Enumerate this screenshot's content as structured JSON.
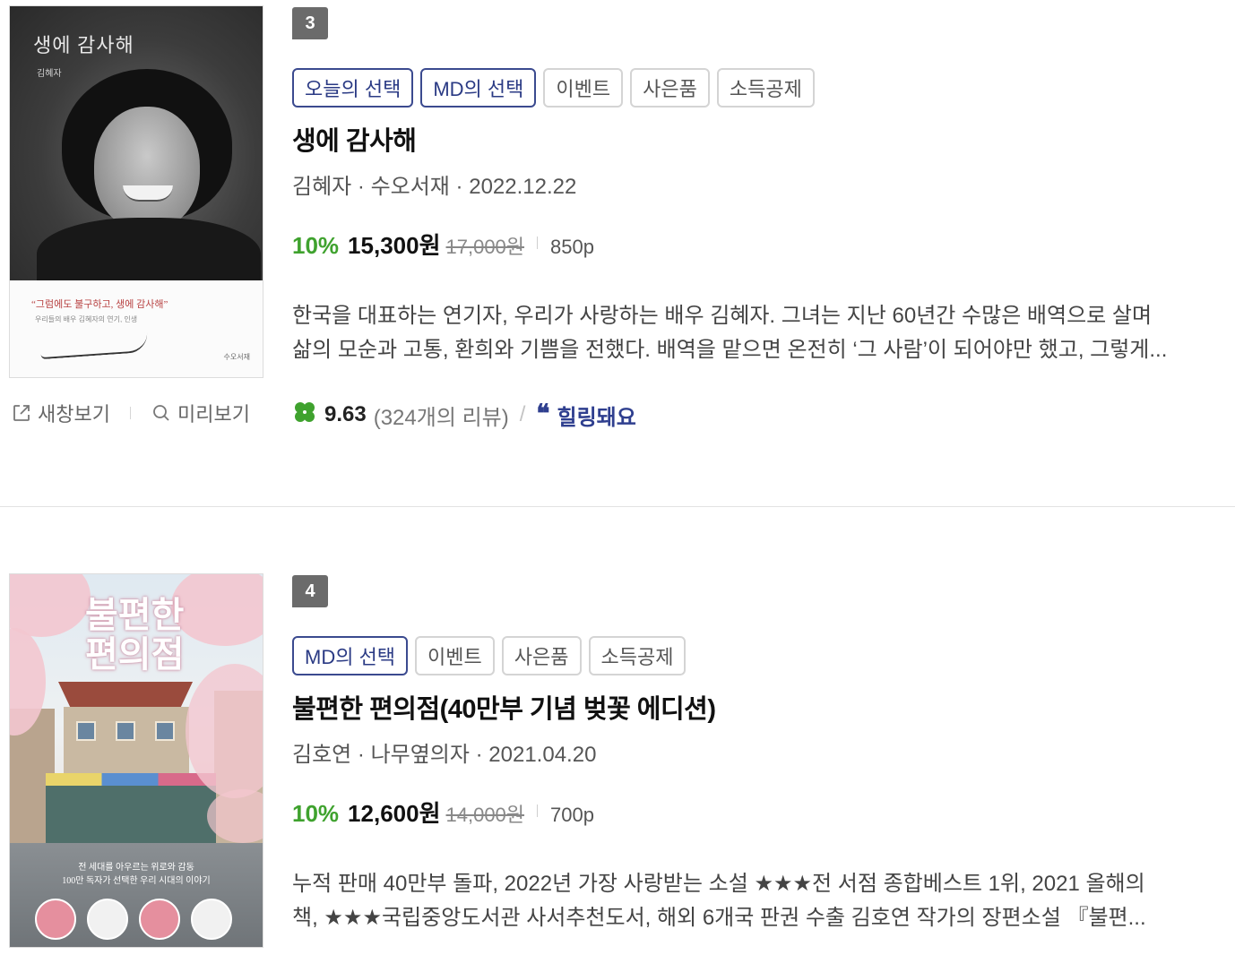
{
  "sub_actions": {
    "new_window_label": "새창보기",
    "preview_label": "미리보기"
  },
  "books": [
    {
      "rank": "3",
      "tags": [
        "오늘의 선택",
        "MD의 선택",
        "이벤트",
        "사은품",
        "소득공제"
      ],
      "title": "생에 감사해",
      "meta": "김혜자 · 수오서재 · 2022.12.22",
      "discount_rate": "10%",
      "sale_price": "15,300원",
      "original_price": "17,000원",
      "pages": "850p",
      "description": [
        "한국을 대표하는 연기자, 우리가 사랑하는 배우 김혜자. 그녀는 지난 60년간 수많은 배역으로 살며",
        "삶의 모순과 고통, 환희와 기쁨을 전했다. 배역을 맡으면 온전히 ‘그 사람’이 되어야만 했고, 그렇게..."
      ],
      "score": "9.63",
      "review_count": "(324개의 리뷰)",
      "review_keyword": "힐링돼요",
      "cover": {
        "title": "생에 감사해",
        "author": "김혜자",
        "quote": "“그럼에도 불구하고, 생에 감사해”",
        "quote_sub": "우리들의 배우 김혜자의 연기, 인생",
        "publisher": "수오서재"
      }
    },
    {
      "rank": "4",
      "tags": [
        "MD의 선택",
        "이벤트",
        "사은품",
        "소득공제"
      ],
      "title": "불편한 편의점(40만부 기념 벚꽃 에디션)",
      "meta": "김호연 · 나무옆의자 · 2021.04.20",
      "discount_rate": "10%",
      "sale_price": "12,600원",
      "original_price": "14,000원",
      "pages": "700p",
      "description": [
        "누적 판매 40만부 돌파, 2022년 가장 사랑받는 소설 ★★★전 서점 종합베스트 1위, 2021 올해의",
        "책, ★★★국립중앙도서관 사서추천도서, 해외 6개국 판권 수출 김호연 작가의 장편소설 『불편..."
      ],
      "cover": {
        "title": "불편한 편의점",
        "blurb_1": "전 세대를 아우르는 위로와 감동",
        "blurb_2": "100만 독자가 선택한 우리 시대의 이야기"
      }
    }
  ],
  "colors": {
    "discount": "#3fa22e",
    "md_tag_border": "#3b4a8f",
    "keyword": "#2f3f8f",
    "rank_bg": "#6b6b6b",
    "clover": "#3fa22e"
  },
  "icons": [
    "external-link-icon",
    "search-icon",
    "clover-icon",
    "quote-icon"
  ]
}
